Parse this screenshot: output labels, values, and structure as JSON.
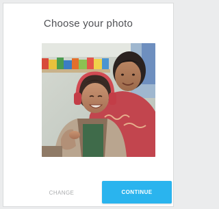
{
  "dialog": {
    "title": "Choose your photo",
    "photo": {
      "alt": "woman-and-child-wearing-headphones",
      "icon": "photo-image"
    },
    "buttons": {
      "change_label": "CHANGE",
      "continue_label": "CONTINUE"
    }
  },
  "colors": {
    "accent": "#2ab4ee",
    "title_text": "#4f5054",
    "secondary_text": "#a9abad"
  }
}
